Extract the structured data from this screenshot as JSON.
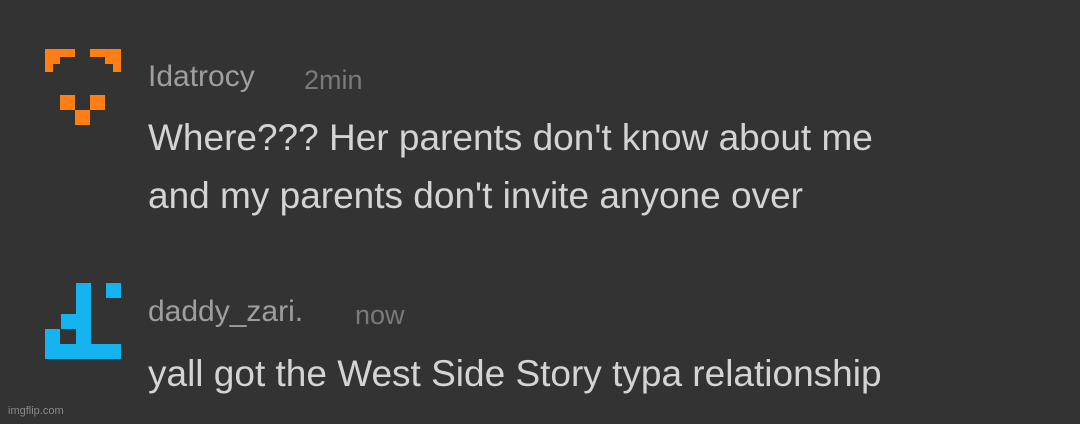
{
  "comments": [
    {
      "username": "Idatrocy",
      "time": "2min",
      "lines": [
        "Where??? Her parents don't know about me",
        "and my parents don't invite anyone over"
      ],
      "avatar_color": "#ff7f14"
    },
    {
      "username": "daddy_zari.",
      "time": "now",
      "lines": [
        "yall got the West Side Story typa relationship"
      ],
      "avatar_color": "#13b4ef"
    }
  ],
  "watermark": "imgflip.com"
}
